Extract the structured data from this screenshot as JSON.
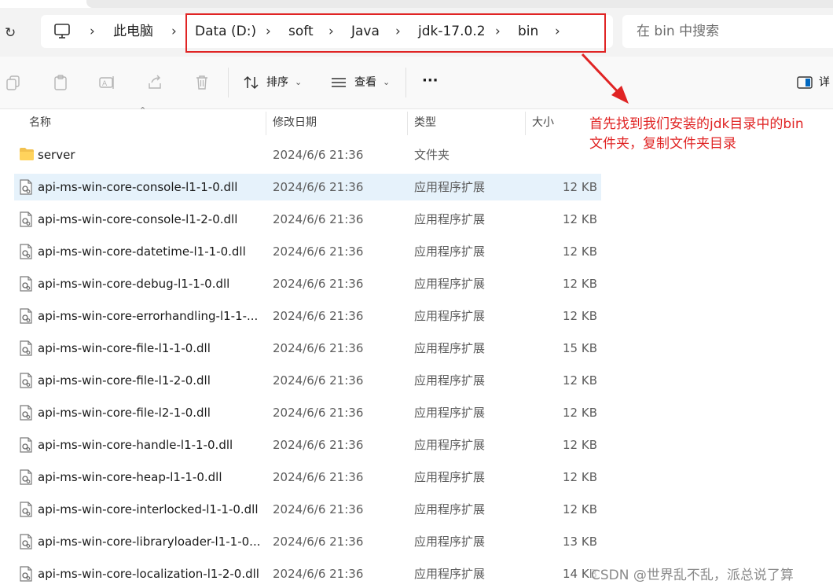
{
  "address": {
    "breadcrumbs": [
      "此电脑",
      "Data (D:)",
      "soft",
      "Java",
      "jdk-17.0.2",
      "bin"
    ],
    "search_placeholder": "在 bin 中搜索"
  },
  "toolbar": {
    "sort_label": "排序",
    "view_label": "查看",
    "more_label": "···",
    "details_label": "详"
  },
  "columns": {
    "name": "名称",
    "date": "修改日期",
    "type": "类型",
    "size": "大小"
  },
  "files": [
    {
      "name": "server",
      "date": "2024/6/6 21:36",
      "type": "文件夹",
      "size": "",
      "kind": "folder"
    },
    {
      "name": "api-ms-win-core-console-l1-1-0.dll",
      "date": "2024/6/6 21:36",
      "type": "应用程序扩展",
      "size": "12 KB",
      "kind": "dll",
      "selected": true
    },
    {
      "name": "api-ms-win-core-console-l1-2-0.dll",
      "date": "2024/6/6 21:36",
      "type": "应用程序扩展",
      "size": "12 KB",
      "kind": "dll"
    },
    {
      "name": "api-ms-win-core-datetime-l1-1-0.dll",
      "date": "2024/6/6 21:36",
      "type": "应用程序扩展",
      "size": "12 KB",
      "kind": "dll"
    },
    {
      "name": "api-ms-win-core-debug-l1-1-0.dll",
      "date": "2024/6/6 21:36",
      "type": "应用程序扩展",
      "size": "12 KB",
      "kind": "dll"
    },
    {
      "name": "api-ms-win-core-errorhandling-l1-1-...",
      "date": "2024/6/6 21:36",
      "type": "应用程序扩展",
      "size": "12 KB",
      "kind": "dll"
    },
    {
      "name": "api-ms-win-core-file-l1-1-0.dll",
      "date": "2024/6/6 21:36",
      "type": "应用程序扩展",
      "size": "15 KB",
      "kind": "dll"
    },
    {
      "name": "api-ms-win-core-file-l1-2-0.dll",
      "date": "2024/6/6 21:36",
      "type": "应用程序扩展",
      "size": "12 KB",
      "kind": "dll"
    },
    {
      "name": "api-ms-win-core-file-l2-1-0.dll",
      "date": "2024/6/6 21:36",
      "type": "应用程序扩展",
      "size": "12 KB",
      "kind": "dll"
    },
    {
      "name": "api-ms-win-core-handle-l1-1-0.dll",
      "date": "2024/6/6 21:36",
      "type": "应用程序扩展",
      "size": "12 KB",
      "kind": "dll"
    },
    {
      "name": "api-ms-win-core-heap-l1-1-0.dll",
      "date": "2024/6/6 21:36",
      "type": "应用程序扩展",
      "size": "12 KB",
      "kind": "dll"
    },
    {
      "name": "api-ms-win-core-interlocked-l1-1-0.dll",
      "date": "2024/6/6 21:36",
      "type": "应用程序扩展",
      "size": "12 KB",
      "kind": "dll"
    },
    {
      "name": "api-ms-win-core-libraryloader-l1-1-0...",
      "date": "2024/6/6 21:36",
      "type": "应用程序扩展",
      "size": "13 KB",
      "kind": "dll"
    },
    {
      "name": "api-ms-win-core-localization-l1-2-0.dll",
      "date": "2024/6/6 21:36",
      "type": "应用程序扩展",
      "size": "14 KB",
      "kind": "dll"
    }
  ],
  "annotation": {
    "line1": "首先找到我们安装的jdk目录中的bin",
    "line2": "文件夹，复制文件夹目录",
    "color": "#e02424"
  },
  "watermark": "CSDN @世界乱不乱，派总说了算",
  "colors": {
    "accent": "#0067c0",
    "selection": "#e6f2fb",
    "annotation": "#e02424"
  }
}
